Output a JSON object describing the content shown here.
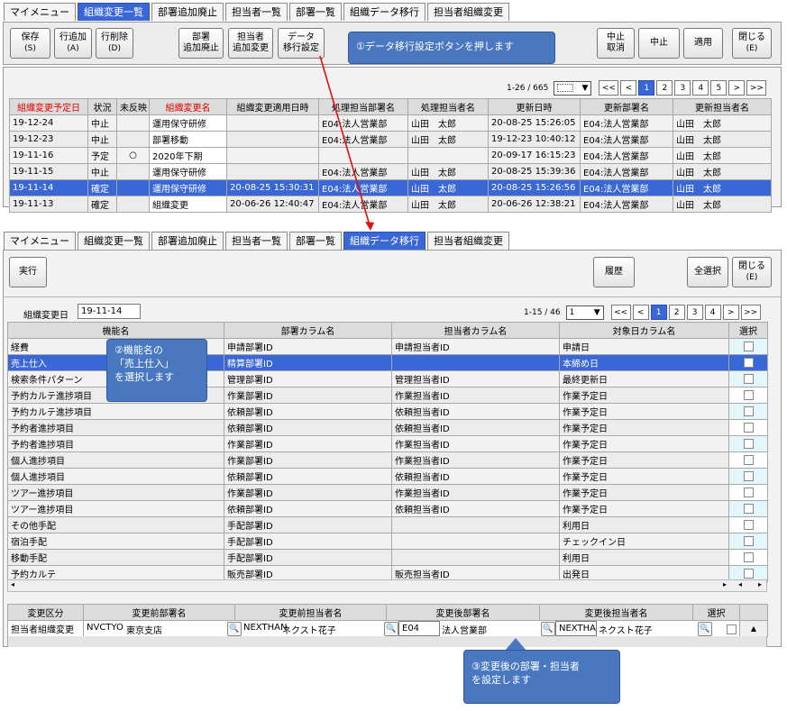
{
  "top": {
    "tabs": [
      "マイメニュー",
      "組織変更一覧",
      "部署追加廃止",
      "担当者一覧",
      "部署一覧",
      "組織データ移行",
      "担当者組織変更"
    ],
    "active_tab": 1,
    "toolbar": {
      "save": [
        "保存",
        "(S)"
      ],
      "add_row": [
        "行追加",
        "(A)"
      ],
      "del_row": [
        "行削除",
        "(D)"
      ],
      "dept": [
        "部署",
        "追加廃止"
      ],
      "staff": [
        "担当者",
        "追加変更"
      ],
      "migrate": [
        "データ",
        "移行設定"
      ],
      "cancel_revert": [
        "中止",
        "取消"
      ],
      "cancel": "中止",
      "apply": "適用",
      "close": [
        "閉じる",
        "(E)"
      ]
    },
    "pager": {
      "range": "1-26 / 665",
      "pages": [
        "<<",
        "<",
        "1",
        "2",
        "3",
        "4",
        "5",
        ">",
        ">>"
      ]
    },
    "columns": [
      "組織変更予定日",
      "状況",
      "未反映",
      "組織変更名",
      "組織変更適用日時",
      "処理担当部署名",
      "処理担当者名",
      "更新日時",
      "更新部署名",
      "更新担当者名"
    ],
    "rows": [
      [
        "19-12-24",
        "中止",
        "",
        "運用保守研修",
        "",
        "E04:法人営業部",
        "山田　太郎",
        "20-08-25 15:26:05",
        "E04:法人営業部",
        "山田　太郎"
      ],
      [
        "19-12-23",
        "中止",
        "",
        "部署移動",
        "",
        "E04:法人営業部",
        "山田　太郎",
        "19-12-23 10:40:12",
        "E04:法人営業部",
        "山田　太郎"
      ],
      [
        "19-11-16",
        "予定",
        "○",
        "2020年下期",
        "",
        "",
        "",
        "20-09-17 16:15:23",
        "E04:法人営業部",
        "山田　太郎"
      ],
      [
        "19-11-15",
        "中止",
        "",
        "運用保守研修",
        "",
        "E04:法人営業部",
        "山田　太郎",
        "20-08-25 15:39:36",
        "E04:法人営業部",
        "山田　太郎"
      ],
      [
        "19-11-14",
        "確定",
        "",
        "運用保守研修",
        "20-08-25 15:30:31",
        "E04:法人営業部",
        "山田　太郎",
        "20-08-25 15:26:56",
        "E04:法人営業部",
        "山田　太郎"
      ],
      [
        "19-11-13",
        "確定",
        "",
        "組織変更",
        "20-06-26 12:40:47",
        "E04:法人営業部",
        "山田　太郎",
        "20-06-26 12:38:21",
        "E04:法人営業部",
        "山田　太郎"
      ]
    ]
  },
  "bottom": {
    "tabs": [
      "マイメニュー",
      "組織変更一覧",
      "部署追加廃止",
      "担当者一覧",
      "部署一覧",
      "組織データ移行",
      "担当者組織変更"
    ],
    "active_tab": 5,
    "toolbar": {
      "run": "実行",
      "history": "履歴",
      "select_all": "全選択",
      "close": [
        "閉じる",
        "(E)"
      ]
    },
    "date_label": "組織変更日",
    "date_value": "19-11-14",
    "pager": {
      "range": "1-15 / 46",
      "select": "1",
      "pages": [
        "<<",
        "<",
        "1",
        "2",
        "3",
        "4",
        ">",
        ">>"
      ]
    },
    "columns": [
      "機能名",
      "部署カラム名",
      "担当者カラム名",
      "対象日カラム名",
      "選択"
    ],
    "rows": [
      [
        "経費",
        "申請部署ID",
        "申請担当者ID",
        "申請日"
      ],
      [
        "売上仕入",
        "精算部署ID",
        "",
        "本締め日"
      ],
      [
        "検索条件パターン",
        "管理部署ID",
        "管理担当者ID",
        "最終更新日"
      ],
      [
        "予約カルテ進捗項目",
        "作業部署ID",
        "作業担当者ID",
        "作業予定日"
      ],
      [
        "予約カルテ進捗項目",
        "依頼部署ID",
        "依頼担当者ID",
        "作業予定日"
      ],
      [
        "予約者進捗項目",
        "依頼部署ID",
        "依頼担当者ID",
        "作業予定日"
      ],
      [
        "予約者進捗項目",
        "作業部署ID",
        "作業担当者ID",
        "作業予定日"
      ],
      [
        "個人進捗項目",
        "作業部署ID",
        "作業担当者ID",
        "作業予定日"
      ],
      [
        "個人進捗項目",
        "依頼部署ID",
        "依頼担当者ID",
        "作業予定日"
      ],
      [
        "ツアー進捗項目",
        "作業部署ID",
        "作業担当者ID",
        "作業予定日"
      ],
      [
        "ツアー進捗項目",
        "依頼部署ID",
        "依頼担当者ID",
        "作業予定日"
      ],
      [
        "その他手配",
        "手配部署ID",
        "",
        "利用日"
      ],
      [
        "宿泊手配",
        "手配部署ID",
        "",
        "チェックイン日"
      ],
      [
        "移動手配",
        "手配部署ID",
        "",
        "利用日"
      ],
      [
        "予約カルテ",
        "販売部署ID",
        "販売担当者ID",
        "出発日"
      ]
    ],
    "change_columns": [
      "変更区分",
      "変更前部署名",
      "変更前担当者名",
      "変更後部署名",
      "変更後担当者名",
      "選択"
    ],
    "change_row": {
      "kind": "担当者組織変更",
      "before_dept_code": "NVCTYO",
      "before_dept_name": "東京支店",
      "before_staff_code": "NEXTHAN",
      "before_staff_name": "ネクスト花子",
      "after_dept_code": "E04",
      "after_dept_name": "法人営業部",
      "after_staff_code": "NEXTHAN",
      "after_staff_name": "ネクスト花子"
    }
  },
  "callouts": {
    "c1": "①データ移行設定ボタンを押します",
    "c2": [
      "②機能名の",
      "「売上仕入」",
      "を選択します"
    ],
    "c3": [
      "③変更後の部署・担当者",
      "を設定します"
    ]
  },
  "colors": {
    "accent": "#3a67d6",
    "callout": "#4a78c0",
    "header_red": "#e00000",
    "arrow": "#e01010"
  }
}
